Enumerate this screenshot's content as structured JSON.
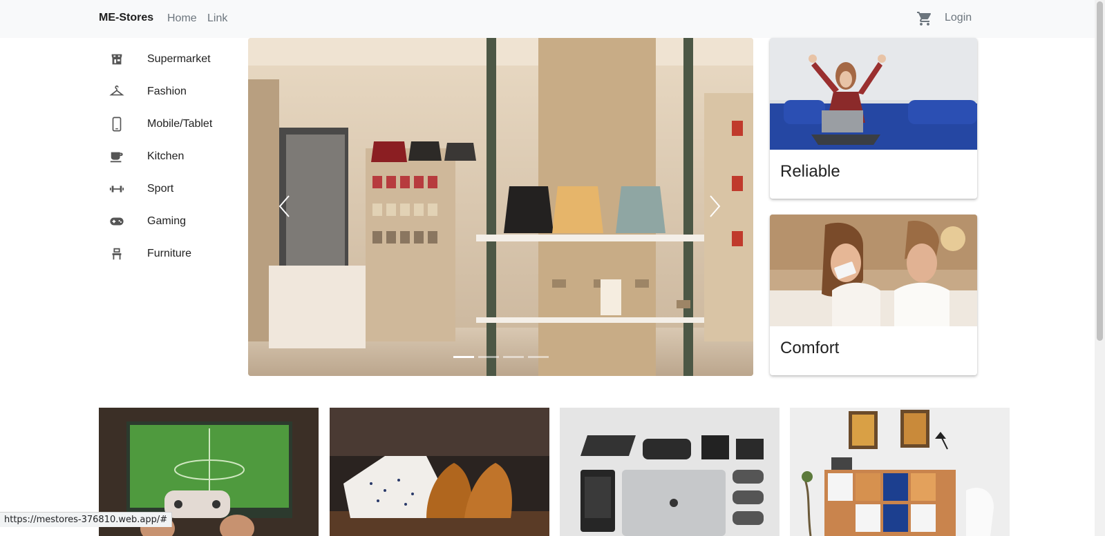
{
  "navbar": {
    "brand": "ME-Stores",
    "links": [
      "Home",
      "Link"
    ],
    "cart_icon": "shopping-cart-icon",
    "login_label": "Login"
  },
  "sidebar": {
    "items": [
      {
        "label": "Supermarket",
        "icon": "store-icon"
      },
      {
        "label": "Fashion",
        "icon": "hanger-icon"
      },
      {
        "label": "Mobile/Tablet",
        "icon": "smartphone-icon"
      },
      {
        "label": "Kitchen",
        "icon": "coffee-cup-icon"
      },
      {
        "label": "Sport",
        "icon": "dumbbell-icon"
      },
      {
        "label": "Gaming",
        "icon": "gamepad-icon"
      },
      {
        "label": "Furniture",
        "icon": "chair-icon"
      }
    ]
  },
  "carousel": {
    "slide_count": 4,
    "active_index": 0
  },
  "features": [
    {
      "title": "Reliable"
    },
    {
      "title": "Comfort"
    }
  ],
  "status_url": "https://mestores-376810.web.app/#",
  "colors": {
    "navbar_bg": "#f8f9fa",
    "link": "#6c757d",
    "text": "#212121"
  }
}
